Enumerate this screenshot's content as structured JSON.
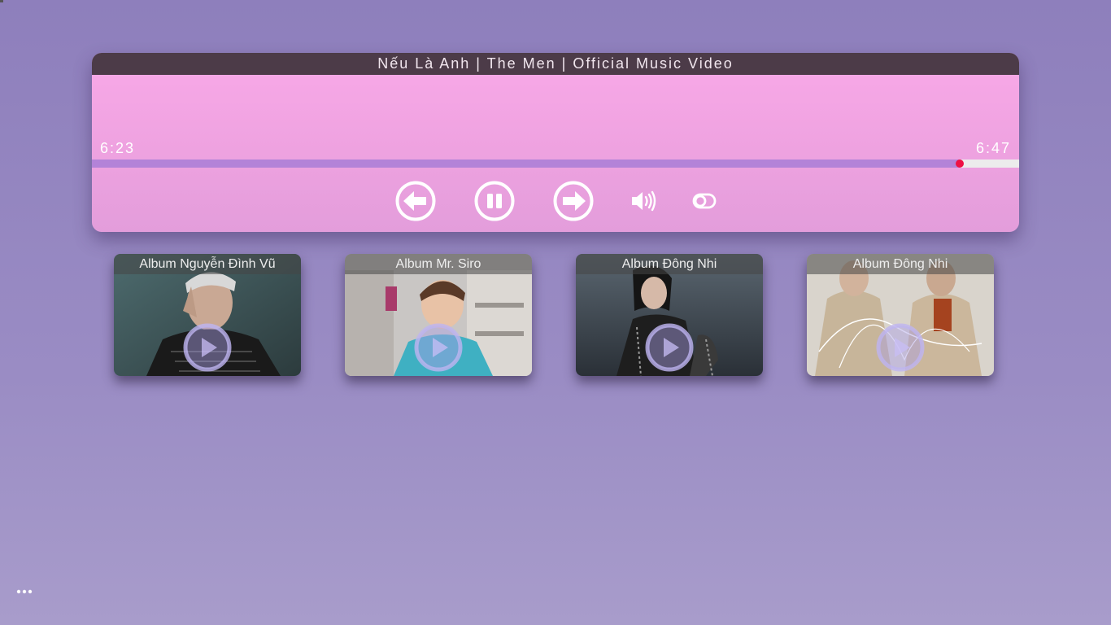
{
  "player": {
    "title": "Nếu Là Anh | The Men | Official Music Video",
    "current_time": "6:23",
    "total_time": "6:47",
    "progress": 0.936,
    "controls": [
      "previous-icon",
      "pause-icon",
      "next-icon",
      "volume-icon",
      "toggle-icon"
    ]
  },
  "albums": [
    {
      "caption": "Album Nguyễn Đình Vũ",
      "play_icon": "play-icon"
    },
    {
      "caption": "Album Mr. Siro",
      "play_icon": "play-icon"
    },
    {
      "caption": "Album Đông Nhi",
      "play_icon": "play-icon"
    },
    {
      "caption": "Album Đông Nhi",
      "play_icon": "play-icon"
    }
  ],
  "more_icon": "more-dots-icon",
  "colors": {
    "title_bar": "#4c3b48",
    "progress_fill": "#b383d8",
    "progress_knob": "#ee1144",
    "player_bg": "#f9a9e8"
  }
}
